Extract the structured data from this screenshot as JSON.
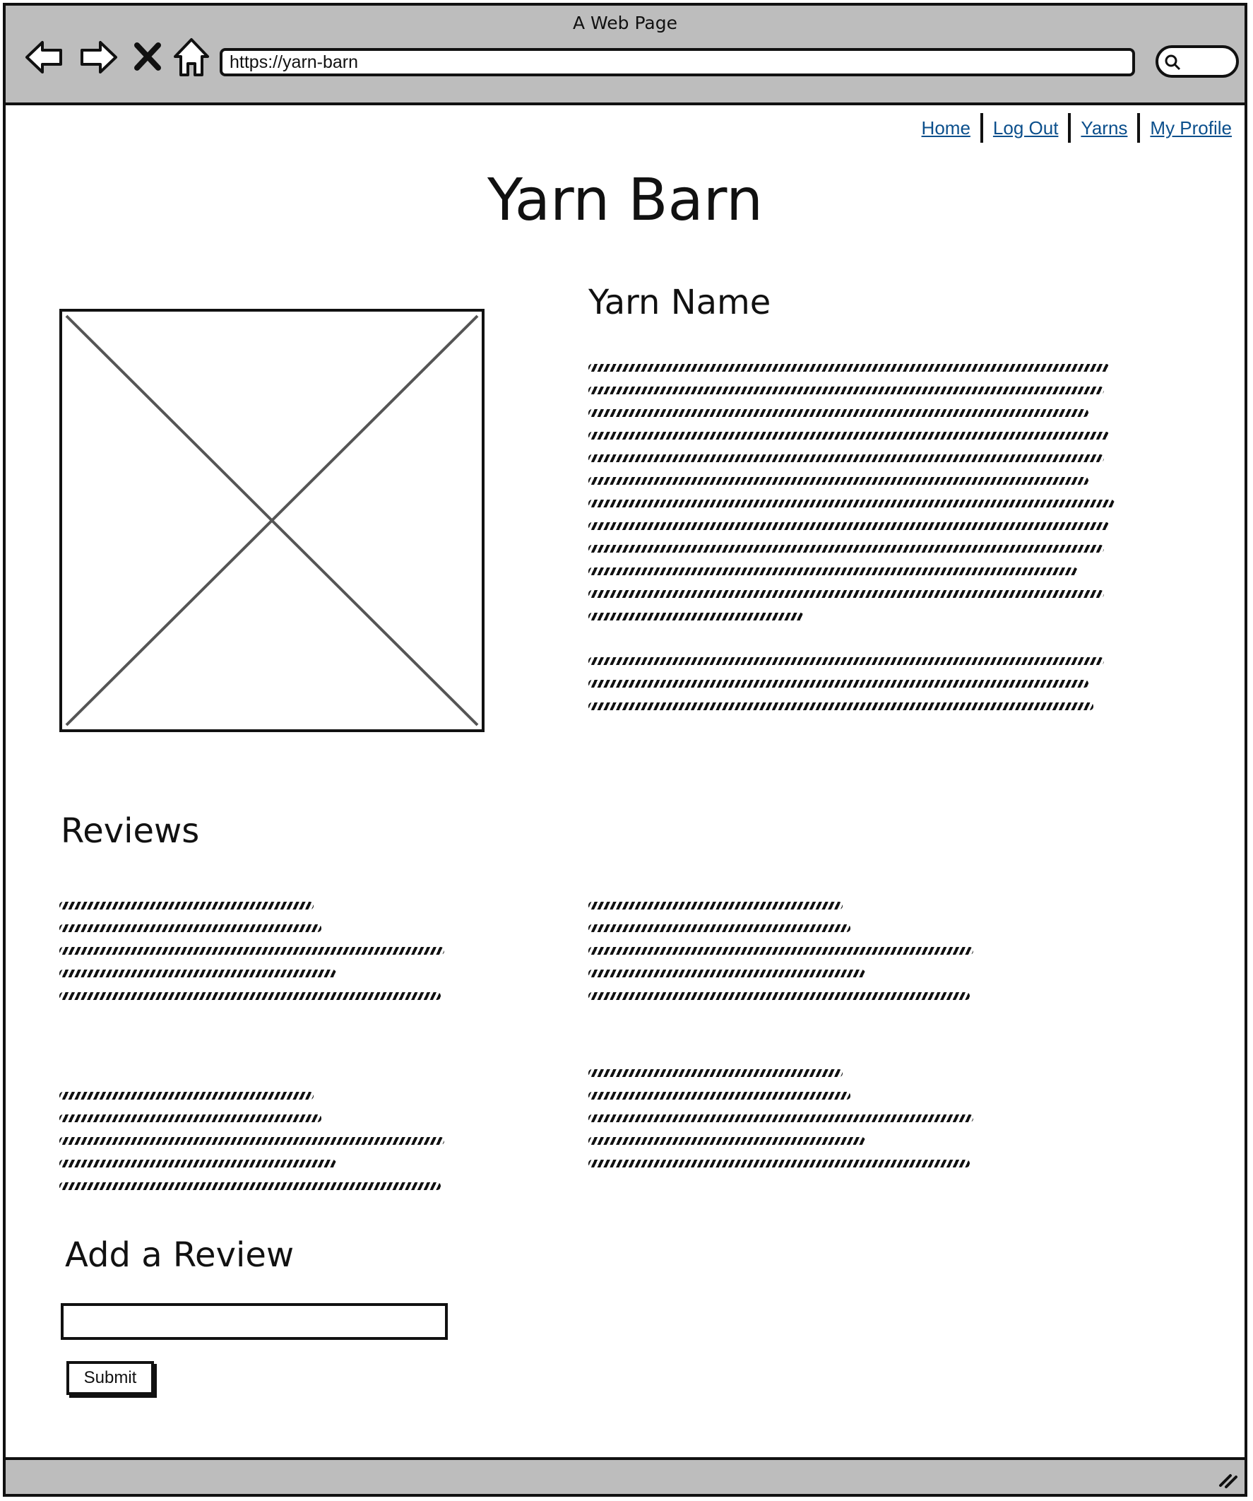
{
  "window": {
    "title": "A Web Page"
  },
  "toolbar": {
    "url": "https://yarn-barn",
    "icons": [
      "back-arrow-icon",
      "forward-arrow-icon",
      "stop-icon",
      "home-icon",
      "search-icon"
    ]
  },
  "nav": {
    "links": [
      {
        "label": "Home"
      },
      {
        "label": "Log Out"
      },
      {
        "label": "Yarns"
      },
      {
        "label": "My Profile"
      }
    ]
  },
  "site": {
    "title": "Yarn Barn"
  },
  "product": {
    "name": "Yarn Name",
    "image_placeholder": "image-placeholder"
  },
  "reviews": {
    "heading": "Reviews"
  },
  "add_review": {
    "heading": "Add a Review",
    "input_value": "",
    "submit_label": "Submit"
  },
  "colors": {
    "chrome": "#bdbdbd",
    "link": "#0b4f8c",
    "ink": "#111111"
  }
}
